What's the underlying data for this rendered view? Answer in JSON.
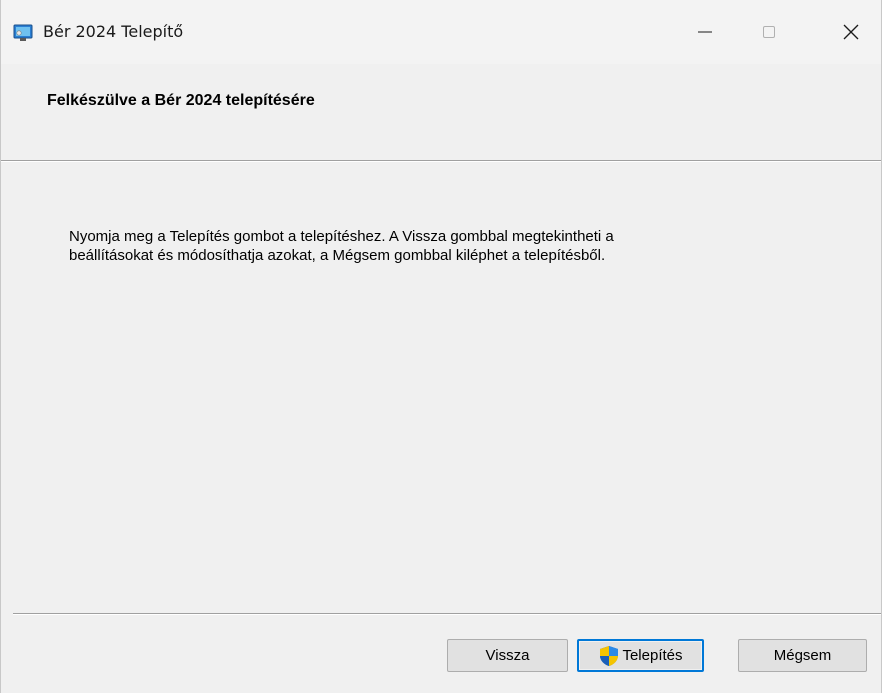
{
  "window": {
    "title": "Bér 2024 Telepítő",
    "icon": "installer-monitor-icon",
    "controls": [
      "minimize-icon",
      "maximize-icon",
      "close-icon"
    ]
  },
  "header": {
    "title": "Felkészülve a Bér 2024 telepítésére"
  },
  "body": {
    "line1": "Nyomja meg a Telepítés gombot a telepítéshez. A Vissza gombbal megtekintheti a",
    "line2": "beállításokat és módosíthatja azokat, a Mégsem gombbal kiléphet a telepítésből."
  },
  "buttons": {
    "back_label": "Vissza",
    "install_label": "Telepítés",
    "install_icon": "uac-shield-icon",
    "cancel_label": "Mégsem"
  },
  "colors": {
    "focus_accent": "#0078d7",
    "shield_blue": "#1f6fd1",
    "shield_yellow": "#f5c400"
  }
}
